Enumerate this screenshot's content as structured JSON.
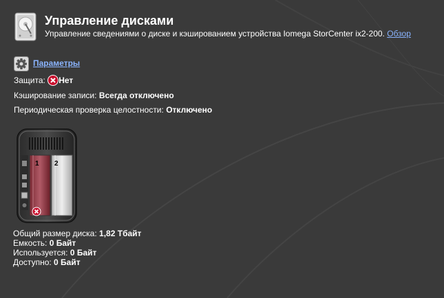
{
  "header": {
    "title": "Управление дисками",
    "subtitle": "Управление сведениями о диске и кэшированием устройства Iomega StorCenter ix2-200.",
    "overview_link": "Обзор",
    "icon": "hard-drive-icon"
  },
  "params": {
    "icon": "gear-icon",
    "link": "Параметры"
  },
  "protection": {
    "label": "Защита:",
    "value": "Нет",
    "icon": "error-x-icon"
  },
  "write_cache": {
    "label": "Кэширование записи:",
    "value": "Всегда отключено"
  },
  "integrity_check": {
    "label": "Периодическая проверка целостности:",
    "value": "Отключено"
  },
  "device": {
    "bay1_label": "1",
    "bay2_label": "2",
    "status_icon": "error-x-icon"
  },
  "stats": {
    "total_label": "Общий размер диска:",
    "total_value": "1,82 Тбайт",
    "capacity_label": "Емкость:",
    "capacity_value": "0 Байт",
    "used_label": "Используется:",
    "used_value": "0 Байт",
    "available_label": "Доступно:",
    "available_value": "0 Байт"
  },
  "colors": {
    "background": "#3a3a3a",
    "link": "#8ab4ff",
    "error": "#c8102e"
  }
}
